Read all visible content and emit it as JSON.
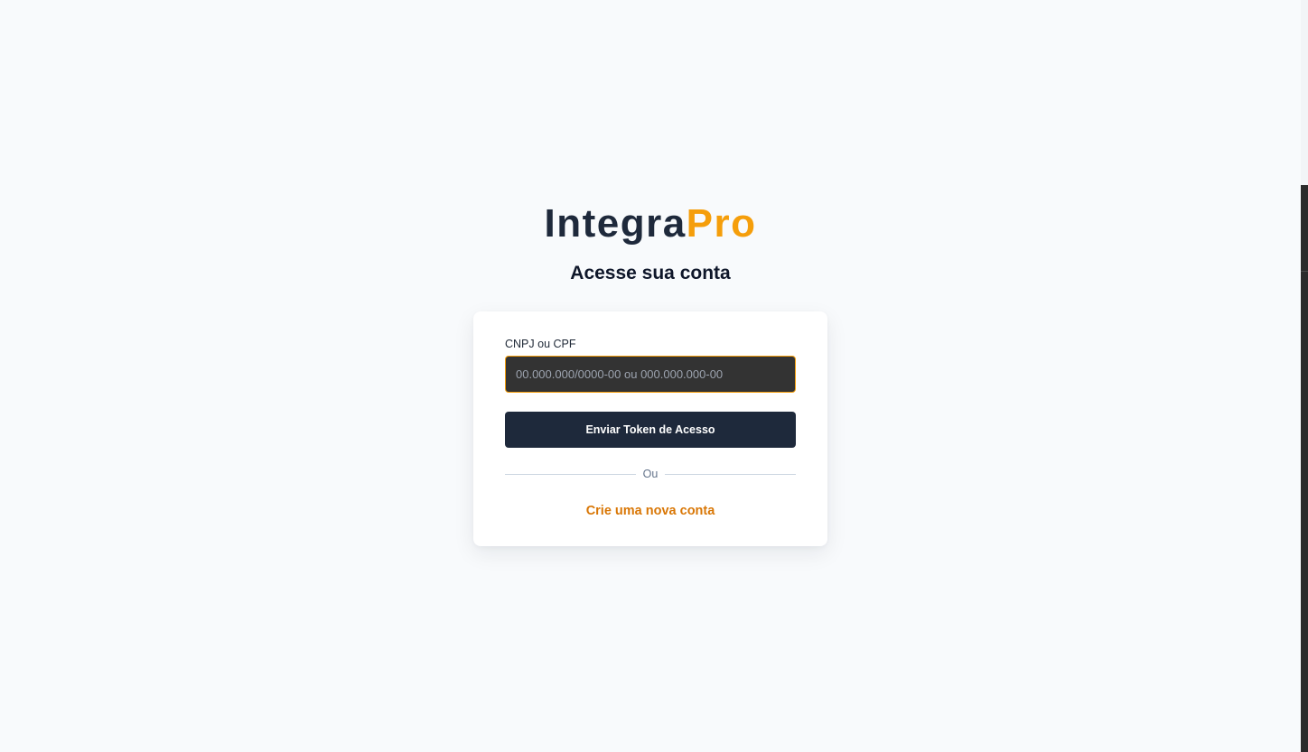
{
  "brand": {
    "part1": "Integra",
    "part2": "Pro",
    "color_part1": "#1e293b",
    "color_part2": "#f59e0b"
  },
  "heading": "Acesse sua conta",
  "form": {
    "document_label": "CNPJ ou CPF",
    "document_value": "",
    "document_placeholder": "00.000.000/0000-00 ou 000.000.000-00",
    "submit_label": "Enviar Token de Acesso",
    "divider_text": "Ou",
    "create_account_label": "Crie uma nova conta"
  },
  "colors": {
    "accent": "#f59e0b",
    "link": "#d97706",
    "button": "#1e293b",
    "background": "#f8fafc"
  }
}
